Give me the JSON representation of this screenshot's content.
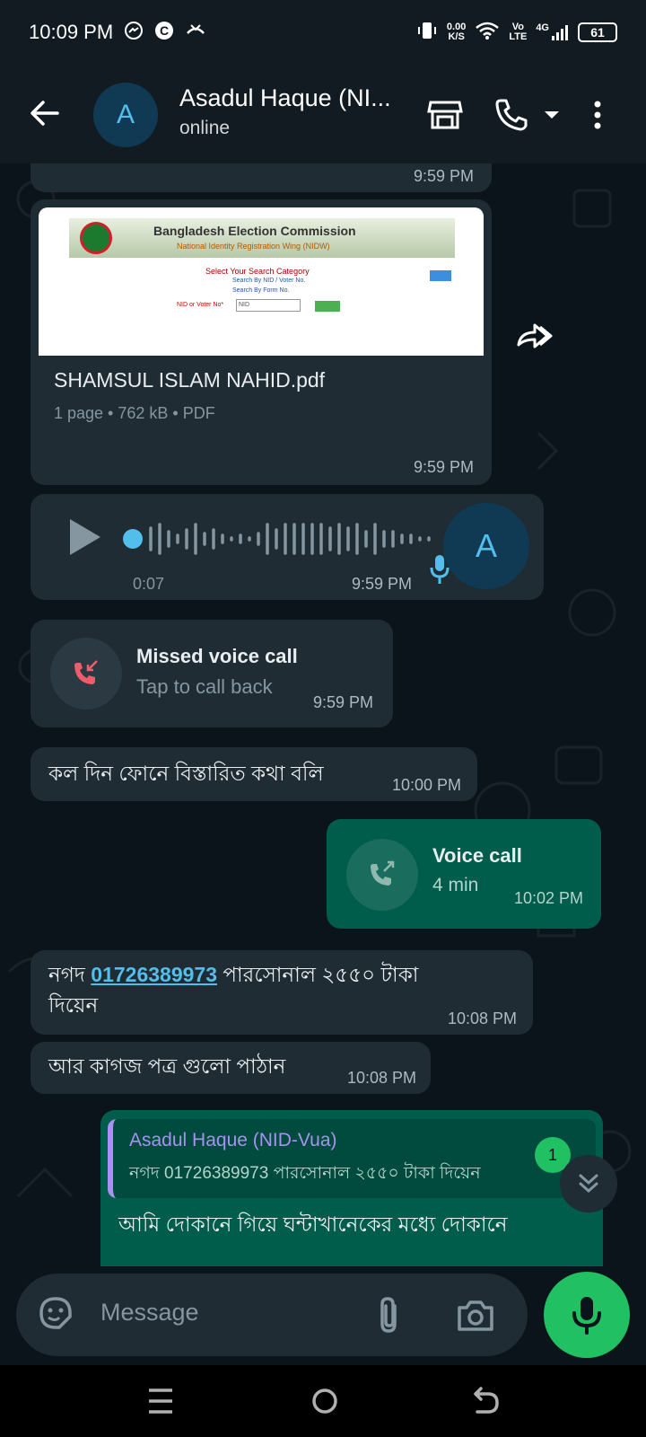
{
  "status_bar": {
    "time": "10:09 PM",
    "net_speed_value": "0.00",
    "net_speed_unit": "K/S",
    "volte": "Vo",
    "lte": "LTE",
    "network": "4G",
    "battery": "61"
  },
  "header": {
    "contact_name": "Asadul Haque (NI...",
    "status": "online",
    "avatar_letter": "A"
  },
  "messages": {
    "m0": {
      "time": "9:59 PM"
    },
    "doc": {
      "preview_title": "Bangladesh Election Commission",
      "preview_subtitle": "National Identity Registration Wing (NIDW)",
      "preview_category": "Select Your Search Category",
      "preview_option1": "Search By NID / Voter No.",
      "preview_option2": "Search By Form No.",
      "preview_field_label": "NID or Voter No*",
      "preview_field_value": "NID",
      "file_name": "SHAMSUL ISLAM NAHID.pdf",
      "meta": "1 page • 762 kB • PDF",
      "time": "9:59 PM"
    },
    "voice": {
      "duration": "0:07",
      "time": "9:59 PM",
      "avatar_letter": "A"
    },
    "missed_call": {
      "title": "Missed voice call",
      "subtitle": "Tap to call back",
      "time": "9:59 PM"
    },
    "m4": {
      "text": "কল দিন ফোনে বিস্তারিত কথা বলি",
      "time": "10:00 PM"
    },
    "voice_call": {
      "title": "Voice call",
      "subtitle": "4 min",
      "time": "10:02 PM"
    },
    "m6": {
      "text_before": "নগদ ",
      "phone": "01726389973",
      "text_after_line1": " পারসোনাল ২৫৫০ টাকা",
      "text_line2": "দিয়েন",
      "time": "10:08 PM"
    },
    "m7": {
      "text": "আর কাগজ পত্র গুলো পাঠান",
      "time": "10:08 PM"
    },
    "m8": {
      "quote_name": "Asadul Haque (NID-Vua)",
      "quote_text": "নগদ 01726389973 পারসোনাল ২৫৫০ টাকা দিয়েন",
      "text": "আমি দোকানে গিয়ে ঘন্টাখানেকের মধ্যে দোকানে"
    },
    "unread_count": "1"
  },
  "input": {
    "placeholder": "Message"
  },
  "colors": {
    "bg": "#0b141a",
    "incoming": "#1f2c34",
    "outgoing": "#005c4b",
    "accent_green": "#21c063",
    "link_blue": "#53bdeb",
    "missed_red": "#f15c6d"
  }
}
